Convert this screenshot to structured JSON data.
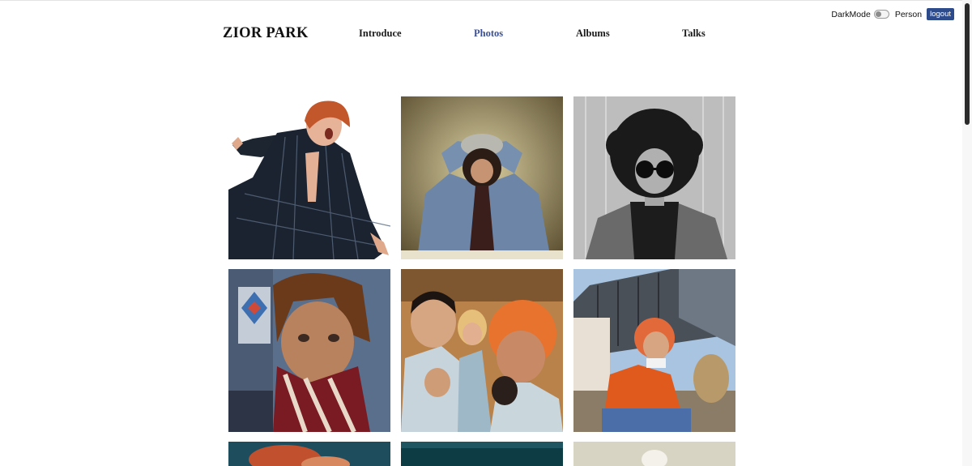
{
  "brand": {
    "name": "ZIOR PARK"
  },
  "nav": {
    "items": [
      {
        "label": "Introduce"
      },
      {
        "label": "Photos",
        "active": true
      },
      {
        "label": "Albums"
      },
      {
        "label": "Talks"
      }
    ]
  },
  "topbar": {
    "darkmode_label": "DarkMode",
    "darkmode_on": false,
    "person_label": "Person",
    "logout_label": "logout"
  },
  "colors": {
    "accent": "#3a4f96",
    "logout_bg": "#2d4a8a",
    "text": "#111111",
    "background": "#ffffff"
  },
  "gallery": {
    "photo_count_visible": 9,
    "photos": [
      {
        "name": "photo-striped-suit-pose",
        "style": "color"
      },
      {
        "name": "photo-hands-on-head-denim",
        "style": "warm"
      },
      {
        "name": "photo-curly-hair-sunglasses",
        "style": "monochrome"
      },
      {
        "name": "photo-closeup-knit-sweater",
        "style": "color"
      },
      {
        "name": "photo-group-selfie",
        "style": "color"
      },
      {
        "name": "photo-orange-sweater-outdoor",
        "style": "color"
      },
      {
        "name": "photo-partial-1",
        "style": "color"
      },
      {
        "name": "photo-partial-2",
        "style": "dark"
      },
      {
        "name": "photo-partial-3",
        "style": "light"
      }
    ]
  }
}
